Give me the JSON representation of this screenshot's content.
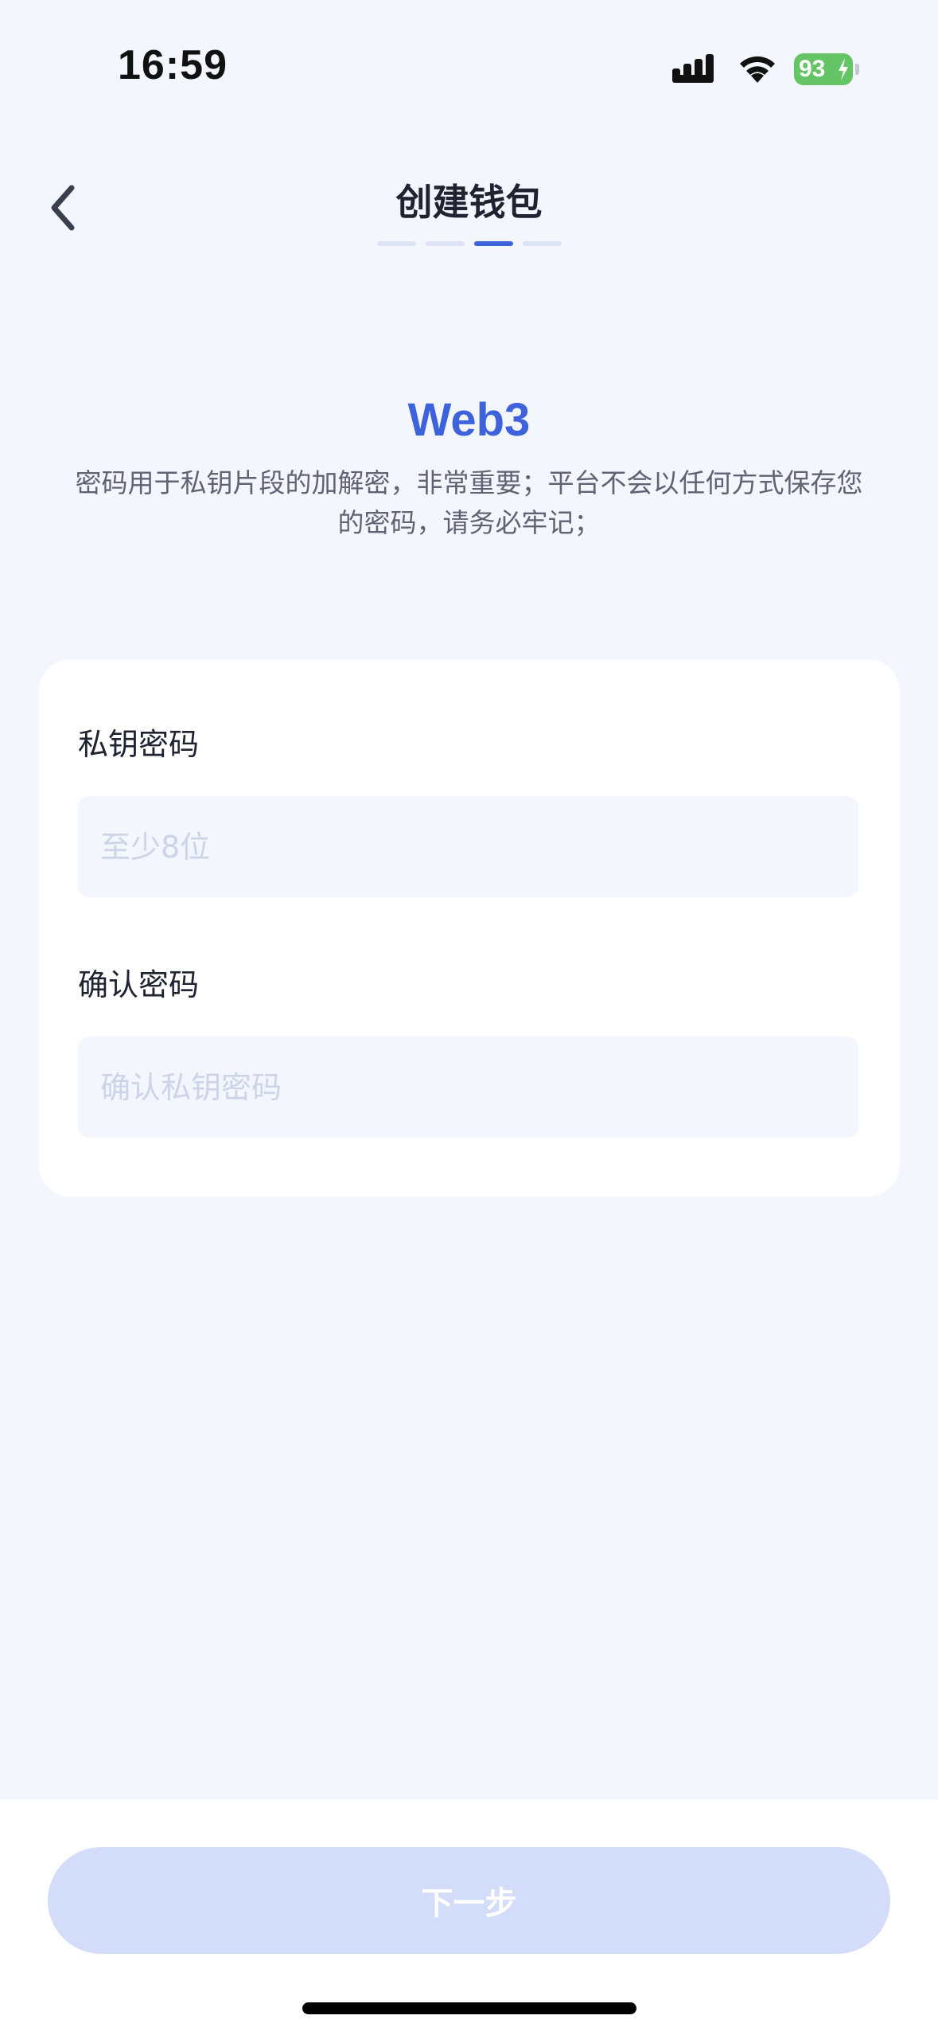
{
  "status_bar": {
    "time": "16:59",
    "battery": "93",
    "battery_color": "#65c466"
  },
  "header": {
    "title": "创建钱包",
    "back_icon": "chevron-left-icon",
    "steps_total": 4,
    "steps_current": 3
  },
  "intro": {
    "brand": "Web3",
    "description": "密码用于私钥片段的加解密，非常重要；平台不会以任何方式保存您的密码，请务必牢记；"
  },
  "form": {
    "password_label": "私钥密码",
    "password_placeholder": "至少8位",
    "password_value": "",
    "confirm_label": "确认密码",
    "confirm_placeholder": "确认私钥密码",
    "confirm_value": ""
  },
  "footer": {
    "next_label": "下一步"
  },
  "colors": {
    "accent": "#3e62dc",
    "background": "#f3f6fd",
    "button_disabled": "#d3ddf9"
  }
}
